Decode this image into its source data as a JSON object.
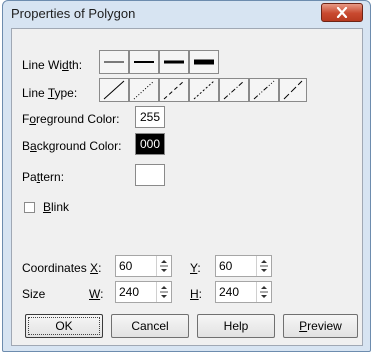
{
  "window": {
    "title": "Properties of Polygon"
  },
  "labels": {
    "line_width": "Line Width:",
    "line_type": "Line Type:",
    "foreground_color": "Foreground Color:",
    "background_color": "Background Color:",
    "pattern": "Pattern:",
    "blink": "Blink",
    "coordinates": "Coordinates",
    "size": "Size",
    "x": "X:",
    "y": "Y:",
    "w": "W:",
    "h": "H:"
  },
  "line_width_options": [
    "1",
    "2",
    "3",
    "4"
  ],
  "line_type_options": [
    "none",
    "solid",
    "dash",
    "dot",
    "dash-dot",
    "dash-dot-dot",
    "long-dash"
  ],
  "colors": {
    "foreground": {
      "value": "255",
      "swatch": "#ffffff",
      "text": "#000000"
    },
    "background": {
      "value": "000",
      "swatch": "#000000",
      "text": "#ffffff"
    },
    "pattern_swatch": "#ffffff"
  },
  "blink_checked": false,
  "fields": {
    "x": "60",
    "y": "60",
    "w": "240",
    "h": "240"
  },
  "buttons": {
    "ok": "OK",
    "cancel": "Cancel",
    "help": "Help",
    "preview": "Preview"
  },
  "icons": {
    "close": "close-icon"
  }
}
